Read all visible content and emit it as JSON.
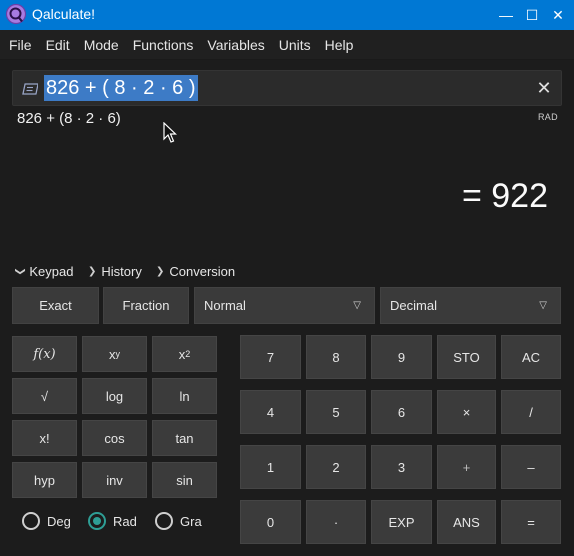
{
  "window": {
    "title": "Qalculate!",
    "minimize": "—",
    "maximize": "☐",
    "close": "✕"
  },
  "menu": [
    "File",
    "Edit",
    "Mode",
    "Functions",
    "Variables",
    "Units",
    "Help"
  ],
  "expression": {
    "value": "826 + ( 8 · 2 · 6 )",
    "clear": "✕"
  },
  "parsed": "826 + (8 · 2 · 6)",
  "angle_unit": "RAD",
  "result": "= 922",
  "sections": {
    "keypad": "Keypad",
    "history": "History",
    "conversion": "Conversion"
  },
  "mode_row": {
    "exact": "Exact",
    "fraction": "Fraction",
    "format": "Normal",
    "base": "Decimal"
  },
  "function_keys": {
    "fx": "f(x)",
    "xy_base": "x",
    "xy_exp": "y",
    "x2_base": "x",
    "x2_exp": "2",
    "sqrt": "√",
    "log": "log",
    "ln": "ln",
    "fact": "x!",
    "cos": "cos",
    "tan": "tan",
    "hyp": "hyp",
    "inv": "inv",
    "sin": "sin"
  },
  "number_keys": {
    "k7": "7",
    "k8": "8",
    "k9": "9",
    "sto": "STO",
    "ac": "AC",
    "k4": "4",
    "k5": "5",
    "k6": "6",
    "mul": "×",
    "div": "/",
    "k1": "1",
    "k2": "2",
    "k3": "3",
    "plus": "+",
    "minus": "–",
    "k0": "0",
    "dot": "·",
    "exp": "EXP",
    "ans": "ANS",
    "eq": "="
  },
  "angle_modes": {
    "deg": "Deg",
    "rad": "Rad",
    "gra": "Gra",
    "selected": "Rad"
  }
}
